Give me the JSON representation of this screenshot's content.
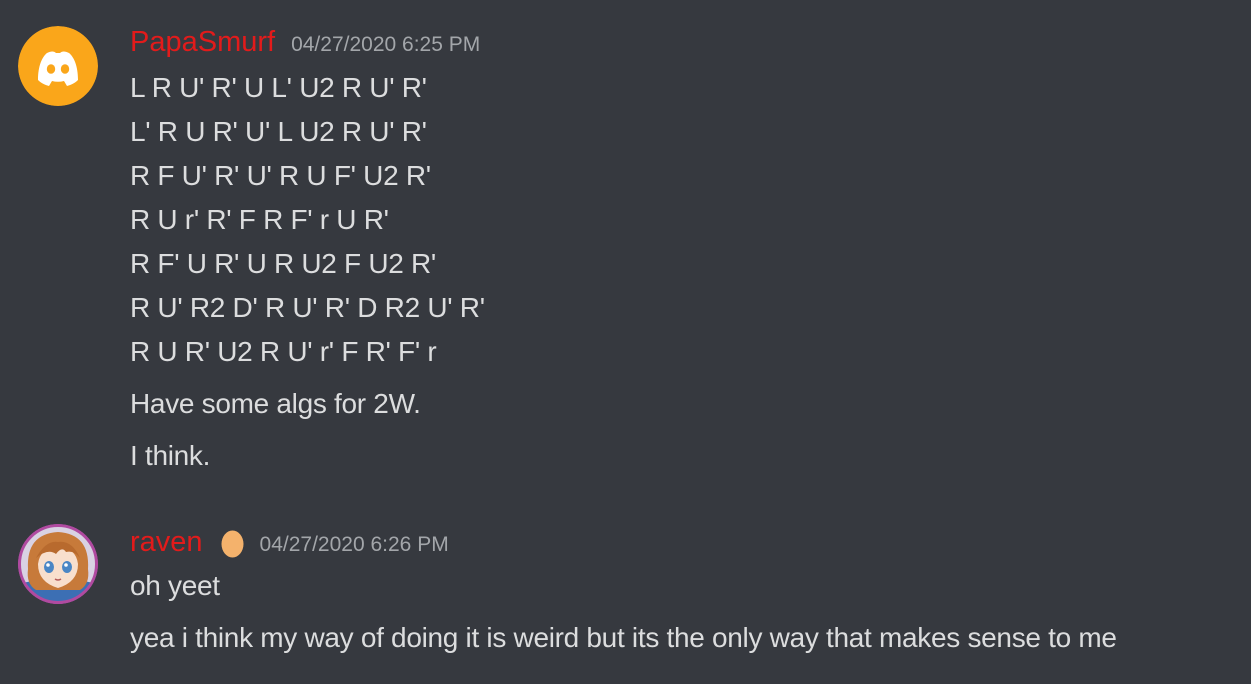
{
  "colors": {
    "background": "#36393f",
    "text": "#dcddde",
    "username": "#e21b1b",
    "timestamp": "#a3a6aa",
    "discord_avatar": "#faa61a",
    "egg": "#f4b26c"
  },
  "messages": [
    {
      "author": "PapaSmurf",
      "timestamp": "04/27/2020 6:25 PM",
      "avatar_icon": "discord-logo-icon",
      "lines": [
        "L R U' R' U L' U2 R U' R'",
        "L' R U R' U' L U2 R U' R'",
        "R F U' R' U' R U F' U2 R'",
        "R U r' R' F R F' r U R'",
        "R F' U R' U R U2 F U2 R'",
        "R U' R2 D' R U' R' D R2 U' R'",
        "R U R' U2 R U' r' F R' F' r",
        "Have some algs for 2W.",
        "I think."
      ]
    },
    {
      "author": "raven",
      "timestamp": "04/27/2020 6:26 PM",
      "avatar_icon": "anime-girl-avatar-icon",
      "badge_icon": "egg-icon",
      "lines": [
        "oh yeet",
        "yea i think my way of doing it is weird but its the only way that makes sense to me"
      ]
    }
  ]
}
